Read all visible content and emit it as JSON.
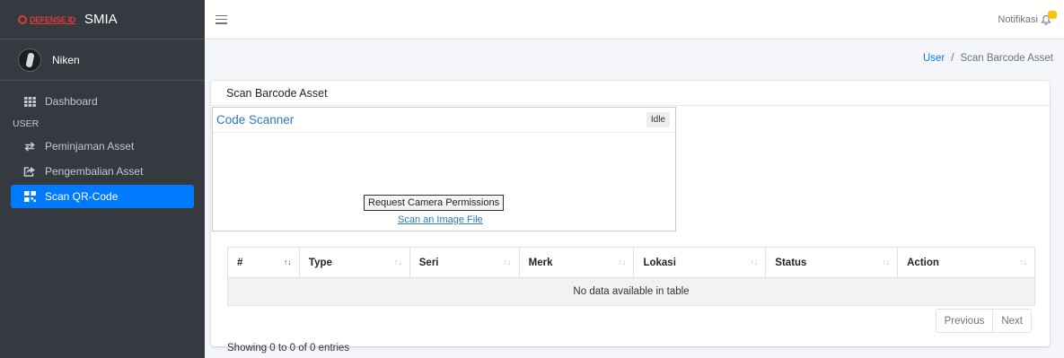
{
  "brand": {
    "logo_text": "DEFENSE ID",
    "app_name": "SMIA"
  },
  "user": {
    "name": "Niken"
  },
  "sidebar": {
    "dashboard": "Dashboard",
    "section_header": "USER",
    "items": [
      {
        "label": "Peminjaman Asset",
        "icon": "exchange-icon"
      },
      {
        "label": "Pengembalian Asset",
        "icon": "share-icon"
      },
      {
        "label": "Scan QR-Code",
        "icon": "qrcode-icon",
        "active": true
      }
    ]
  },
  "topbar": {
    "notif_label": "Notifikasi"
  },
  "breadcrumb": {
    "link": "User",
    "separator": "/",
    "current": "Scan Barcode Asset"
  },
  "card": {
    "title": "Scan Barcode Asset"
  },
  "scanner": {
    "title": "Code Scanner",
    "status": "Idle",
    "permission_button": "Request Camera Permissions",
    "scan_file_link": "Scan an Image File"
  },
  "table": {
    "columns": [
      "#",
      "Type",
      "Seri",
      "Merk",
      "Lokasi",
      "Status",
      "Action"
    ],
    "empty_message": "No data available in table",
    "info": "Showing 0 to 0 of 0 entries"
  },
  "pagination": {
    "previous": "Previous",
    "next": "Next"
  },
  "colors": {
    "accent": "#007bff",
    "sidebar_bg": "#343a40",
    "badge": "#ffc107",
    "brand_red": "#e53935"
  }
}
